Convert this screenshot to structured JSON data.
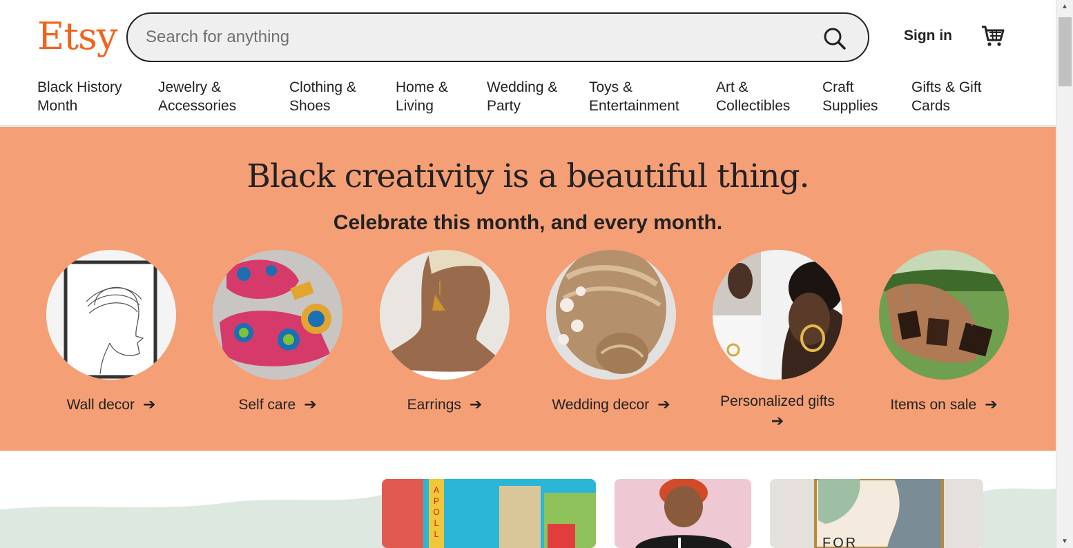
{
  "header": {
    "logo": "Etsy",
    "search_placeholder": "Search for anything",
    "signin_label": "Sign in"
  },
  "nav": {
    "items": [
      {
        "line1": "Black History",
        "line2": "Month"
      },
      {
        "line1": "Jewelry &",
        "line2": "Accessories"
      },
      {
        "line1": "Clothing &",
        "line2": "Shoes"
      },
      {
        "line1": "Home &",
        "line2": "Living"
      },
      {
        "line1": "Wedding &",
        "line2": "Party"
      },
      {
        "line1": "Toys &",
        "line2": "Entertainment"
      },
      {
        "line1": "Art &",
        "line2": "Collectibles"
      },
      {
        "line1": "Craft",
        "line2": "Supplies"
      },
      {
        "line1": "Gifts & Gift",
        "line2": "Cards"
      }
    ]
  },
  "hero": {
    "title": "Black creativity is a beautiful thing.",
    "subtitle": "Celebrate this month, and every month.",
    "categories": [
      {
        "label": "Wall decor"
      },
      {
        "label": "Self care"
      },
      {
        "label": "Earrings"
      },
      {
        "label": "Wedding decor"
      },
      {
        "label": "Personalized gifts"
      },
      {
        "label": "Items on sale"
      }
    ],
    "arrow": "➔"
  },
  "colors": {
    "brand": "#f1641e",
    "hero_bg": "#f59f76",
    "text": "#222222"
  },
  "icons": {
    "search": "search-icon",
    "cart": "cart-icon",
    "arrow": "arrow-right-icon"
  }
}
